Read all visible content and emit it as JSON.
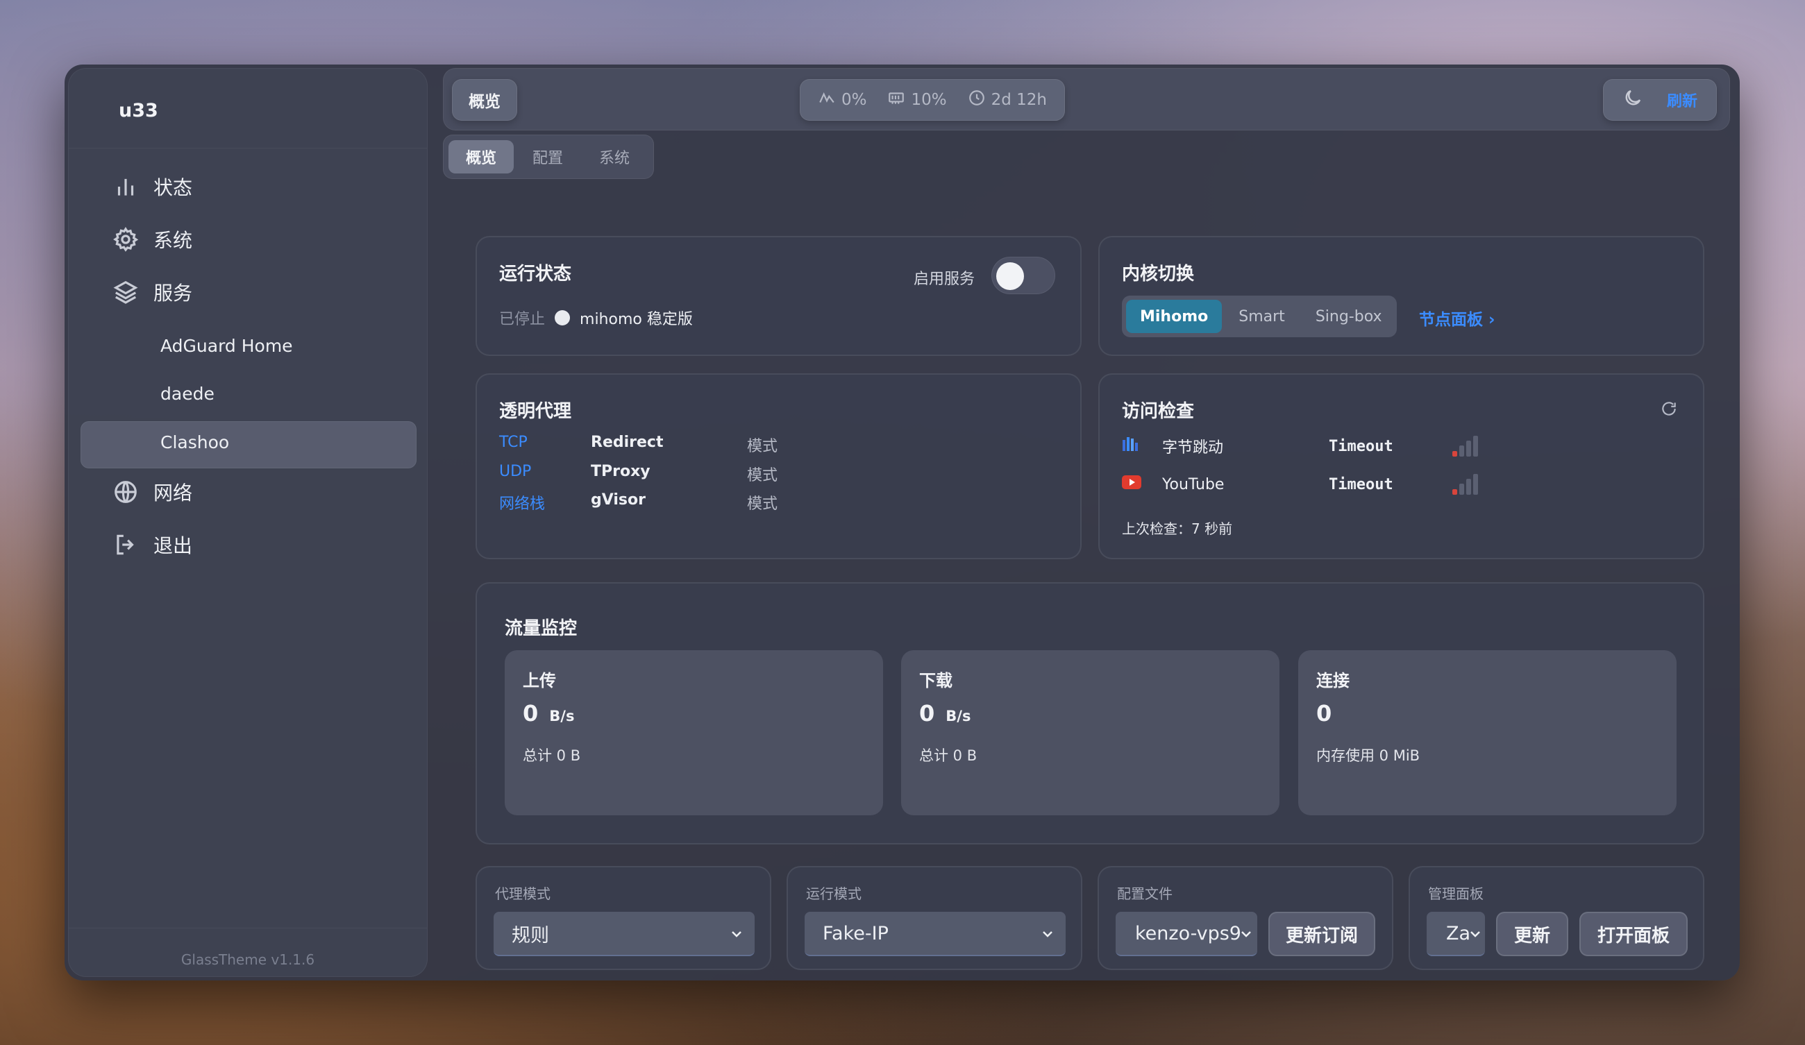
{
  "sidebar": {
    "brand": "u33",
    "nav": {
      "status": "状态",
      "system": "系统",
      "services": "服务",
      "network": "网络",
      "logout": "退出"
    },
    "service_items": [
      "AdGuard Home",
      "daede",
      "Clashoo"
    ],
    "active_service": "Clashoo",
    "version": "GlassTheme v1.1.6"
  },
  "topbar": {
    "title": "概览",
    "cpu": "0%",
    "mem": "10%",
    "uptime": "2d 12h",
    "refresh": "刷新"
  },
  "tabs": [
    "概览",
    "配置",
    "系统"
  ],
  "active_tab": "概览",
  "run_status": {
    "title": "运行状态",
    "service_label": "启用服务",
    "service_enabled": false,
    "state": "已停止",
    "version": "mihomo 稳定版"
  },
  "core_switch": {
    "title": "内核切换",
    "options": [
      "Mihomo",
      "Smart",
      "Sing-box"
    ],
    "active": "Mihomo",
    "node_panel": "节点面板 ›"
  },
  "transparent_proxy": {
    "title": "透明代理",
    "rows": [
      {
        "proto": "TCP",
        "value": "Redirect",
        "mode": "模式"
      },
      {
        "proto": "UDP",
        "value": "TProxy",
        "mode": "模式"
      },
      {
        "proto": "网络栈",
        "value": "gVisor",
        "mode": "模式"
      }
    ]
  },
  "access_check": {
    "title": "访问检查",
    "rows": [
      {
        "name": "字节跳动",
        "result": "Timeout",
        "icon": "bytedance-icon"
      },
      {
        "name": "YouTube",
        "result": "Timeout",
        "icon": "youtube-icon"
      }
    ],
    "last_check": "上次检查：7 秒前"
  },
  "traffic": {
    "title": "流量监控",
    "upload": {
      "label": "上传",
      "value": "0",
      "unit": "B/s",
      "total": "总计 0 B"
    },
    "download": {
      "label": "下载",
      "value": "0",
      "unit": "B/s",
      "total": "总计 0 B"
    },
    "connections": {
      "label": "连接",
      "value": "0",
      "memory": "内存使用 0 MiB"
    }
  },
  "bottom": {
    "proxy_mode": {
      "label": "代理模式",
      "value": "规则"
    },
    "run_mode": {
      "label": "运行模式",
      "value": "Fake-IP"
    },
    "config_file": {
      "label": "配置文件",
      "value": "kenzo-vps9",
      "update_sub": "更新订阅"
    },
    "dashboard": {
      "label": "管理面板",
      "value": "Za",
      "update": "更新",
      "open": "打开面板"
    }
  },
  "colors": {
    "accent": "#3b8cff",
    "active_core": "#2a7b9c",
    "signal_red": "#d8453c"
  }
}
